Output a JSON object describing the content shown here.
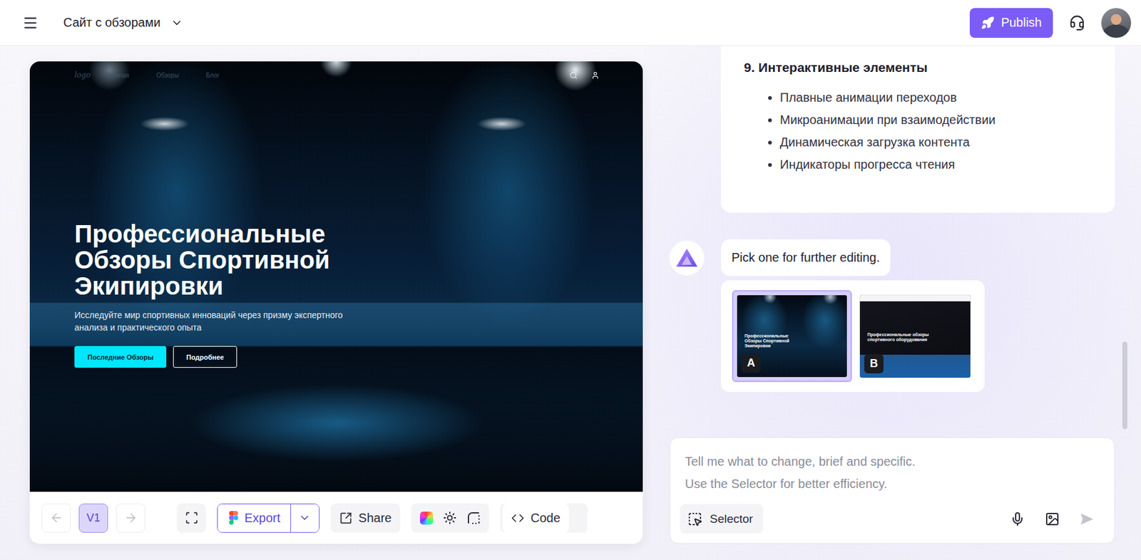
{
  "header": {
    "project": "Сайт с обзорами",
    "publish": "Publish"
  },
  "preview": {
    "logo": "logo",
    "nav": [
      "Главная",
      "Обзоры",
      "Блог"
    ],
    "title_lines": [
      "Профессиональные",
      "Обзоры Спортивной",
      "Экипировки"
    ],
    "subtitle": "Исследуйте мир спортивных инноваций через призму экспертного анализа и практического опыта",
    "buttons": [
      {
        "label": "Последние Обзоры",
        "primary": true
      },
      {
        "label": "Подробнее",
        "primary": false
      }
    ]
  },
  "toolbar": {
    "back": {
      "disabled": true
    },
    "forward": {
      "disabled": true
    },
    "versions": [
      {
        "label": "V1",
        "selected": true
      }
    ],
    "export": "Export",
    "share": "Share",
    "code": "Code"
  },
  "chat": {
    "section": {
      "title": "9. Интерактивные элементы",
      "items": [
        "Плавные анимации переходов",
        "Микроанимации при взаимодействии",
        "Динамическая загрузка контента",
        "Индикаторы прогресса чтения"
      ]
    },
    "message": "Pick one for further editing.",
    "options": [
      {
        "label": "A",
        "selected": true,
        "title": "Профессиональные Обзоры Спортивной Экипировки"
      },
      {
        "label": "B",
        "selected": false,
        "title": "Профессиональные обзоры спортивного оборудования"
      }
    ]
  },
  "composer": {
    "placeholder_lines": [
      "Tell me what to change, brief and specific.",
      "Use the Selector for better efficiency."
    ],
    "selector": "Selector"
  }
}
